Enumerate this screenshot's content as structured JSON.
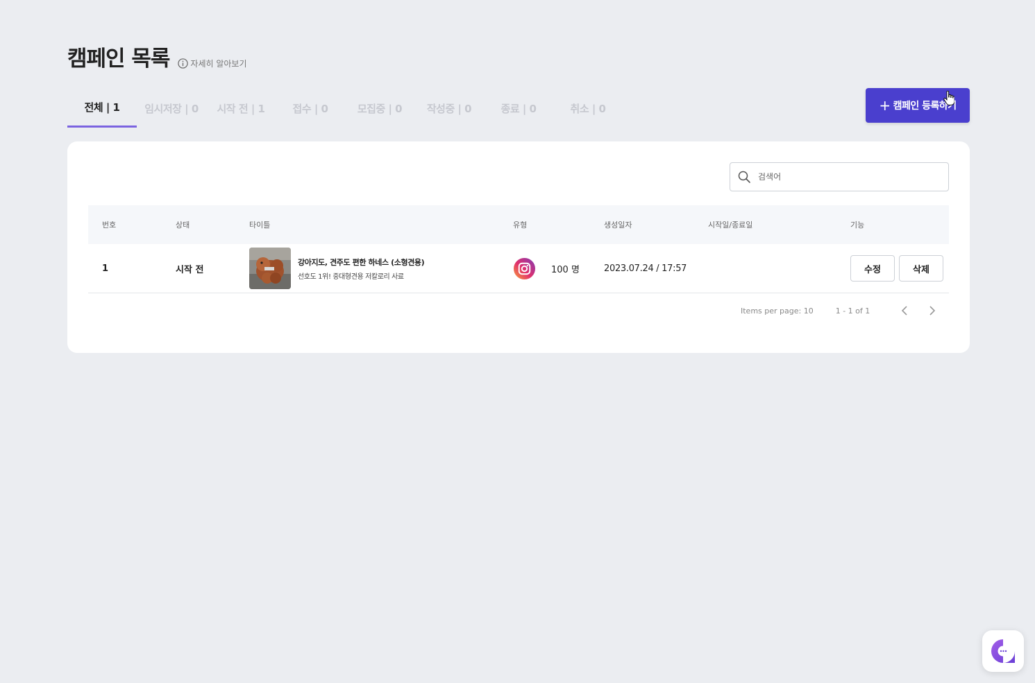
{
  "header": {
    "title": "캠페인 목록",
    "help_label": "자세히 알아보기"
  },
  "tabs": [
    {
      "label": "전체 | 1",
      "active": true
    },
    {
      "label": "임시저장 | 0"
    },
    {
      "label": "시작 전 | 1"
    },
    {
      "label": "접수 | 0"
    },
    {
      "label": "모집중 | 0"
    },
    {
      "label": "작성중 | 0"
    },
    {
      "label": "종료 | 0"
    },
    {
      "label": "취소 | 0"
    }
  ],
  "add_button": {
    "label": "캠페인 등록하기"
  },
  "search": {
    "placeholder": "검색어"
  },
  "table": {
    "headers": {
      "no": "번호",
      "status": "상태",
      "title": "타이틀",
      "type": "유형",
      "created": "생성일자",
      "period": "시작일/종료일",
      "actions": "기능"
    },
    "rows": [
      {
        "no": "1",
        "status": "시작 전",
        "title": "강아지도, 견주도 편한 하네스 (소형견용)",
        "subtitle": "선호도 1위! 중대형견용 저칼로리 사료",
        "type_icon": "instagram-icon",
        "count": "100 명",
        "created": "2023.07.24 / 17:57",
        "period": "",
        "edit_label": "수정",
        "delete_label": "삭제"
      }
    ]
  },
  "pagination": {
    "per_page": "Items per page: 10",
    "range": "1 - 1 of 1"
  },
  "colors": {
    "primary": "#4a3fce",
    "tab_active_underline": "#7b63e0",
    "background": "#ebedf1"
  }
}
